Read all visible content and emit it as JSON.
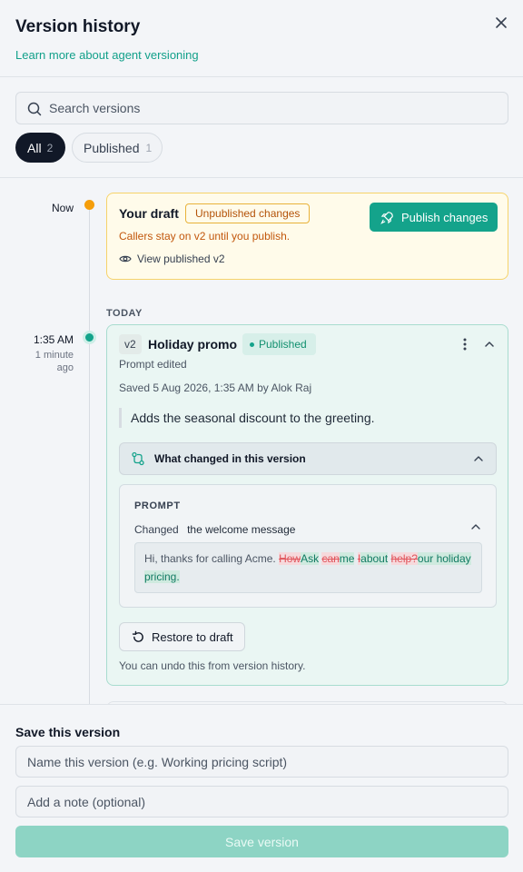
{
  "header": {
    "title": "Version history",
    "learn_link": "Learn more about agent versioning"
  },
  "search": {
    "placeholder": "Search versions"
  },
  "filters": [
    {
      "label": "All",
      "count": "2",
      "selected": true
    },
    {
      "label": "Published",
      "count": "1",
      "selected": false
    }
  ],
  "timeline": {
    "now_label": "Now",
    "draft": {
      "title": "Your draft",
      "badge": "Unpublished changes",
      "subtitle": "Callers stay on v2 until you publish.",
      "view_link": "View published v2",
      "publish_label": "Publish changes"
    },
    "section_label": "TODAY",
    "version": {
      "time": "1:35 AM",
      "time_ago_1": "1 minute",
      "time_ago_2": "ago",
      "tag": "v2",
      "name": "Holiday promo",
      "status": "Published",
      "change_type": "Prompt edited",
      "saved": "Saved 5 Aug 2026, 1:35 AM by Alok Raj",
      "note": "Adds the seasonal discount to the greeting.",
      "what_changed_label": "What changed in this version",
      "prompt_heading": "PROMPT",
      "changed_word": "Changed",
      "changed_target": "the welcome message",
      "diff": {
        "plain_1": "Hi, thanks for calling Acme. ",
        "del_1": "How",
        "ins_1": "Ask",
        "plain_2": " ",
        "del_2": "can",
        "ins_2": "me",
        "plain_3": " ",
        "del_3": "I",
        "ins_3": "about",
        "plain_4": " ",
        "del_4": "help?",
        "ins_4": "our holiday pricing."
      },
      "restore_label": "Restore to draft",
      "undo_note": "You can undo this from version history."
    }
  },
  "footer": {
    "title": "Save this version",
    "name_placeholder": "Name this version (e.g. Working pricing script)",
    "note_placeholder": "Add a note (optional)",
    "save_label": "Save version"
  },
  "colors": {
    "accent": "#14a38b",
    "draft_border": "#f6d36a",
    "warning_text": "#c2570c",
    "deleted": "#e0555c",
    "inserted": "#117a62"
  },
  "icons": [
    "close-icon",
    "search-icon",
    "timeline-dot-icon",
    "rocket-icon",
    "eye-icon",
    "more-vertical-icon",
    "chevron-up-icon",
    "git-compare-icon",
    "restore-icon"
  ]
}
